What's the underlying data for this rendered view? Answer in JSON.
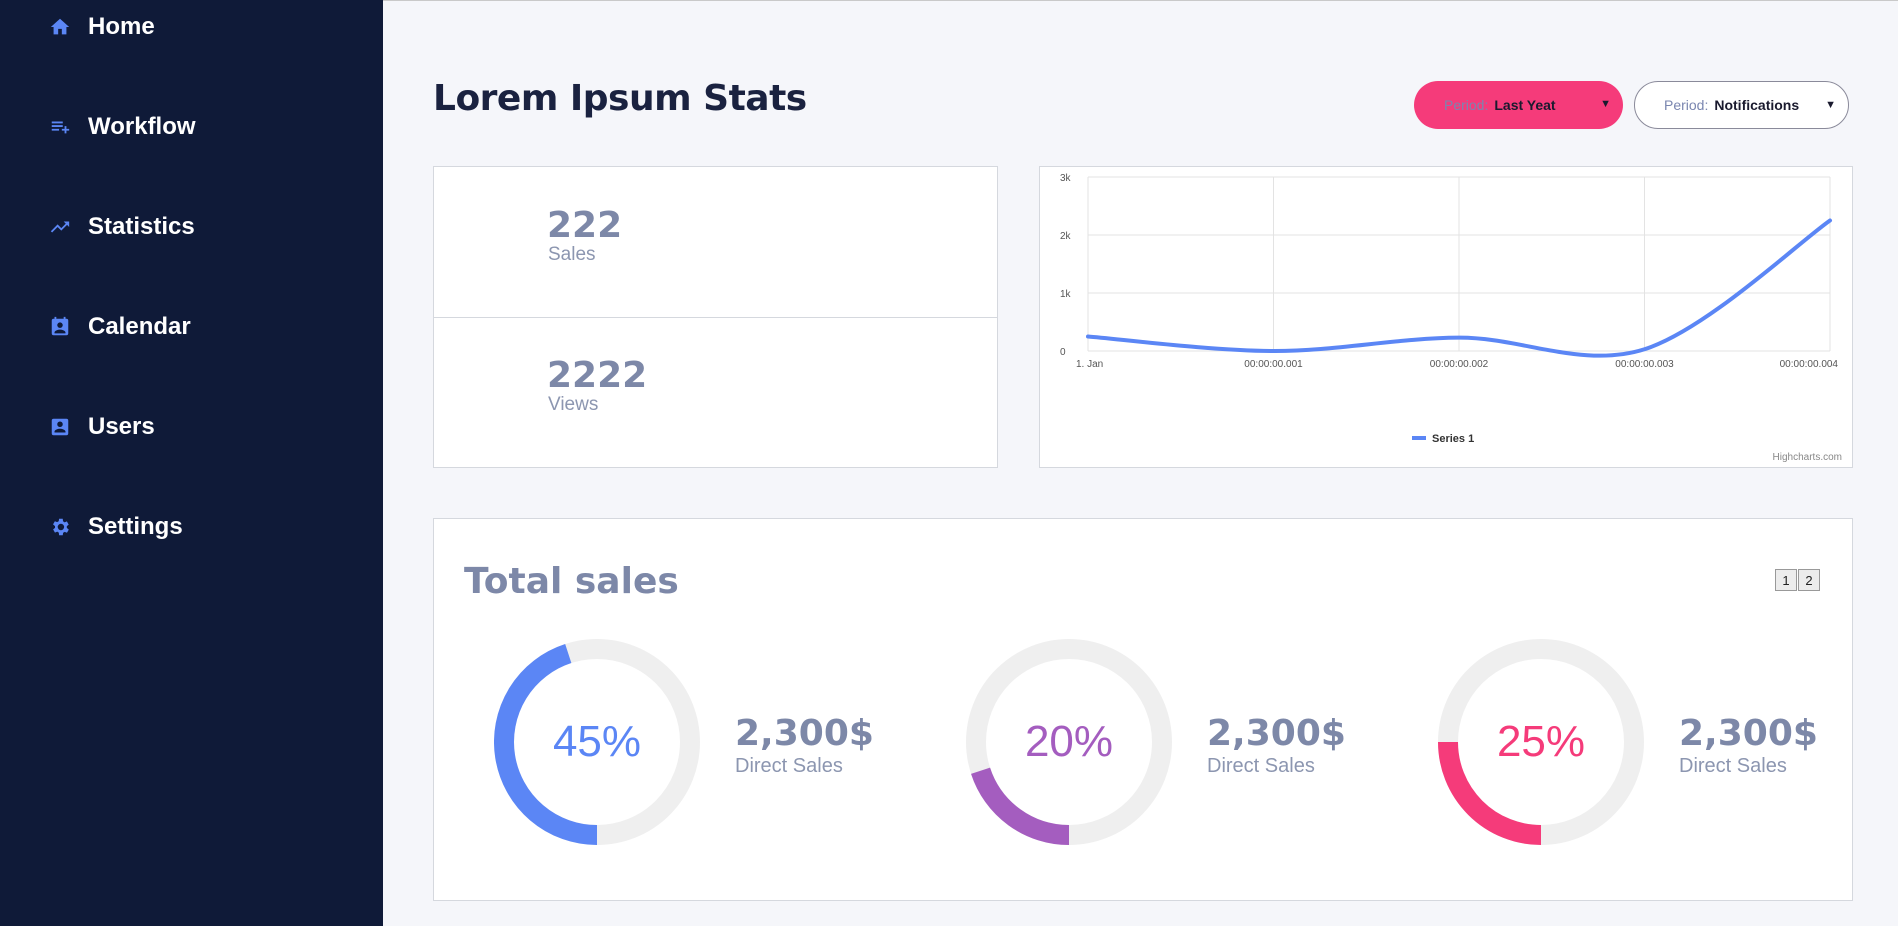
{
  "sidebar": {
    "items": [
      {
        "label": "Home",
        "icon": "home-icon"
      },
      {
        "label": "Workflow",
        "icon": "playlist-add-icon"
      },
      {
        "label": "Statistics",
        "icon": "trending-up-icon"
      },
      {
        "label": "Calendar",
        "icon": "calendar-icon"
      },
      {
        "label": "Users",
        "icon": "user-box-icon"
      },
      {
        "label": "Settings",
        "icon": "gear-icon"
      }
    ]
  },
  "header": {
    "title": "Lorem Ipsum Stats",
    "period_select": {
      "prefix": "Period:",
      "value": "Last Yeat"
    },
    "notifications_select": {
      "prefix": "Period:",
      "value": "Notifications"
    }
  },
  "stats": {
    "sales": {
      "value": "222",
      "label": "Sales"
    },
    "views": {
      "value": "2222",
      "label": "Views"
    }
  },
  "chart_data": {
    "type": "line",
    "x": [
      "1. Jan",
      "00:00:00.001",
      "00:00:00.002",
      "00:00:00.003",
      "00:00:00.004"
    ],
    "series": [
      {
        "name": "Series 1",
        "values": [
          250,
          0,
          230,
          30,
          2250
        ],
        "color": "#5b86f5"
      }
    ],
    "y_ticks": [
      "0",
      "1k",
      "2k",
      "3k"
    ],
    "ylim": [
      0,
      3000
    ],
    "grid": true,
    "legend": "bottom-center",
    "credits": "Highcharts.com"
  },
  "total_sales": {
    "title": "Total sales",
    "pages": [
      "1",
      "2"
    ],
    "items": [
      {
        "percent": "45%",
        "fraction": 0.45,
        "color": "#5b86f5",
        "amount": "2,300$",
        "label": "Direct Sales"
      },
      {
        "percent": "20%",
        "fraction": 0.2,
        "color": "#a45dbf",
        "amount": "2,300$",
        "label": "Direct Sales"
      },
      {
        "percent": "25%",
        "fraction": 0.25,
        "color": "#f53b7a",
        "amount": "2,300$",
        "label": "Direct Sales"
      }
    ]
  },
  "colors": {
    "sidebar_bg": "#0f1a38",
    "accent": "#5b86f5",
    "pink": "#f53b7a",
    "purple": "#a45dbf",
    "ring_track": "#efefef"
  }
}
